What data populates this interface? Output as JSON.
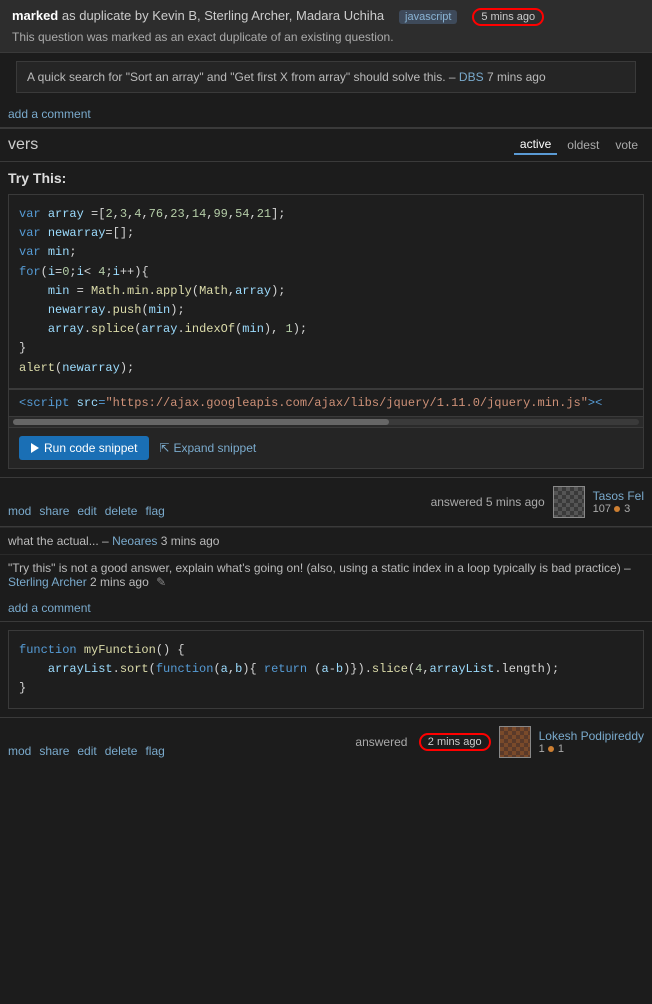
{
  "duplicate_banner": {
    "marked_text": "marked",
    "rest_text": " as duplicate by Kevin B, Sterling Archer, Madara Uchiha",
    "tag": "javascript",
    "time": "5 mins ago",
    "subtitle": "This question was marked as an exact duplicate of an existing question."
  },
  "comment": {
    "text": "A quick search for \"Sort an array\" and \"Get first X from array\" should solve this.",
    "dash": "–",
    "user": "DBS",
    "time": "7 mins ago"
  },
  "add_comment": "add a comment",
  "answers_header": {
    "title": "vers",
    "sort_tabs": [
      "active",
      "oldest",
      "vote"
    ]
  },
  "answer1": {
    "try_this": "Try This:",
    "code_lines": [
      "var array =[2,3,4,76,23,14,99,54,21];",
      "var newarray=[];",
      "var min;",
      "for(i=0;i< 4;i++){",
      "    min = Math.min.apply(Math,array);",
      "    newarray.push(min);",
      "    array.splice(array.indexOf(min), 1);",
      "}",
      "alert(newarray);"
    ],
    "script_src": "<script src=\"https://ajax.googleapis.com/ajax/libs/jquery/1.11.0/jquery.min.js\">",
    "run_btn": "Run code snippet",
    "expand_btn": "Expand snippet",
    "actions": [
      "mod",
      "share",
      "edit",
      "delete",
      "flag"
    ],
    "answered": "answered 5 mins ago",
    "user_name": "Tasos Fel",
    "user_rep": "107",
    "user_dots": "3"
  },
  "comments": [
    {
      "text": "what the actual...",
      "dash": "–",
      "user": "Neoares",
      "time": "3 mins ago"
    },
    {
      "text": "\"Try this\" is not a good answer, explain what's going on! (also, using a static index in a loop typically is bad practice)",
      "dash": "–",
      "user": "Sterling Archer",
      "time": "2 mins ago"
    }
  ],
  "answer2": {
    "code_lines": [
      "function myFunction() {",
      "    arrayList.sort(function(a,b){ return (a-b)}).slice(4,arrayList.length);",
      "}"
    ],
    "actions": [
      "mod",
      "share",
      "edit",
      "delete",
      "flag"
    ],
    "answered": "answered 2 mins ago",
    "time_badge": "2 mins ago",
    "user_name": "Lokesh Podipireddy",
    "user_rep": "1",
    "user_dots": "1"
  }
}
